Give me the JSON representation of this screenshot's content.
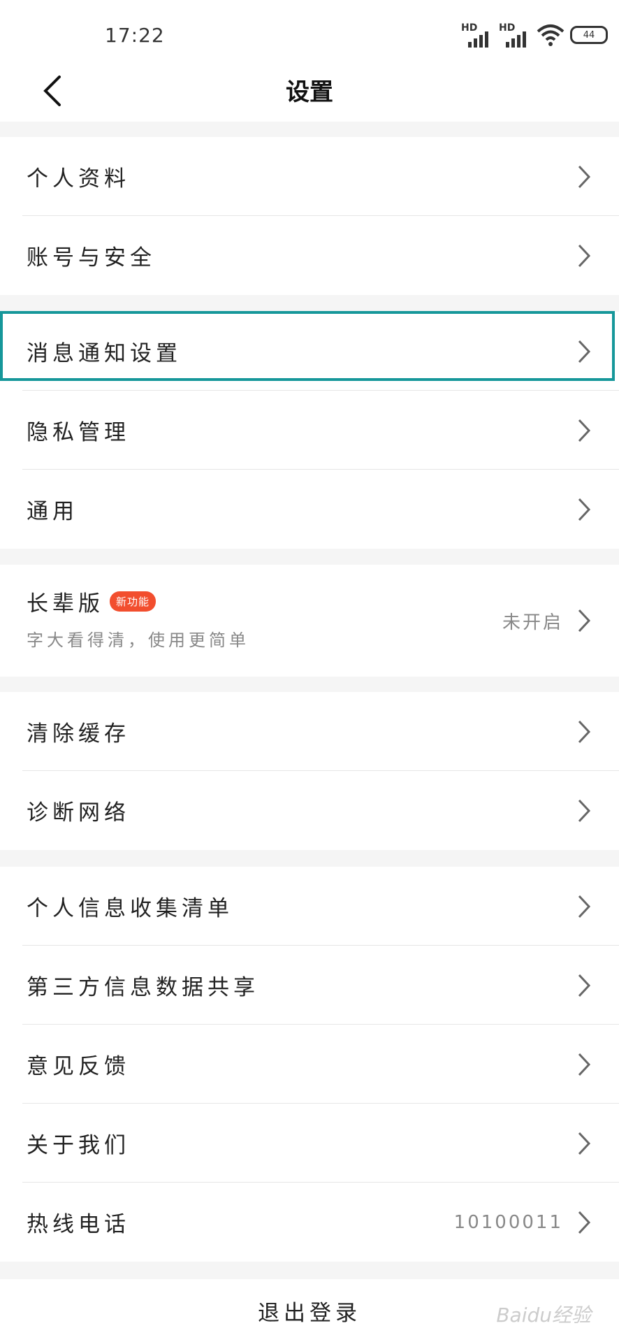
{
  "status": {
    "time": "17:22",
    "battery": "44",
    "hd1": "HD",
    "hd2": "HD"
  },
  "header": {
    "title": "设置"
  },
  "group1": [
    {
      "label": "个人资料"
    },
    {
      "label": "账号与安全"
    }
  ],
  "group2": [
    {
      "label": "消息通知设置"
    },
    {
      "label": "隐私管理"
    },
    {
      "label": "通用"
    }
  ],
  "elder": {
    "label": "长辈版",
    "badge": "新功能",
    "subtitle": "字大看得清，使用更简单",
    "value": "未开启"
  },
  "group4": [
    {
      "label": "清除缓存"
    },
    {
      "label": "诊断网络"
    }
  ],
  "group5": [
    {
      "label": "个人信息收集清单"
    },
    {
      "label": "第三方信息数据共享"
    },
    {
      "label": "意见反馈"
    },
    {
      "label": "关于我们"
    },
    {
      "label": "热线电话",
      "value": "10100011"
    }
  ],
  "logout": "退出登录",
  "watermark": "Baidu经验",
  "colors": {
    "highlight": "#16979a",
    "badge": "#f24e2e"
  }
}
